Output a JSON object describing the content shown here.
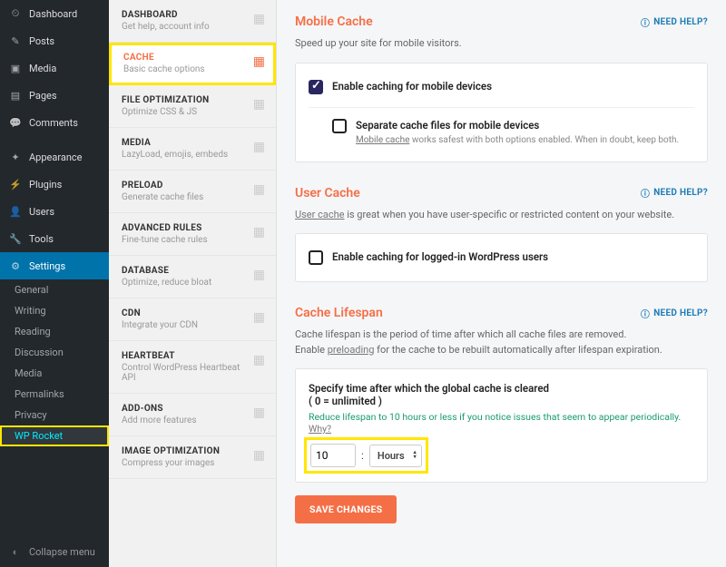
{
  "wp_sidebar": {
    "items": [
      {
        "label": "Dashboard",
        "icon": "speed"
      },
      {
        "label": "Posts",
        "icon": "pin"
      },
      {
        "label": "Media",
        "icon": "media"
      },
      {
        "label": "Pages",
        "icon": "page"
      },
      {
        "label": "Comments",
        "icon": "comment"
      },
      {
        "label": "Appearance",
        "icon": "brush"
      },
      {
        "label": "Plugins",
        "icon": "plug"
      },
      {
        "label": "Users",
        "icon": "user"
      },
      {
        "label": "Tools",
        "icon": "wrench"
      },
      {
        "label": "Settings",
        "icon": "gear",
        "active": true
      }
    ],
    "subitems": [
      {
        "label": "General"
      },
      {
        "label": "Writing"
      },
      {
        "label": "Reading"
      },
      {
        "label": "Discussion"
      },
      {
        "label": "Media"
      },
      {
        "label": "Permalinks"
      },
      {
        "label": "Privacy"
      },
      {
        "label": "WP Rocket",
        "highlight": true
      }
    ],
    "collapse": "Collapse menu"
  },
  "rocket_nav": [
    {
      "title": "DASHBOARD",
      "sub": "Get help, account info"
    },
    {
      "title": "CACHE",
      "sub": "Basic cache options",
      "active": true
    },
    {
      "title": "FILE OPTIMIZATION",
      "sub": "Optimize CSS & JS"
    },
    {
      "title": "MEDIA",
      "sub": "LazyLoad, emojis, embeds"
    },
    {
      "title": "PRELOAD",
      "sub": "Generate cache files"
    },
    {
      "title": "ADVANCED RULES",
      "sub": "Fine-tune cache rules"
    },
    {
      "title": "DATABASE",
      "sub": "Optimize, reduce bloat"
    },
    {
      "title": "CDN",
      "sub": "Integrate your CDN"
    },
    {
      "title": "HEARTBEAT",
      "sub": "Control WordPress Heartbeat API"
    },
    {
      "title": "ADD-ONS",
      "sub": "Add more features"
    },
    {
      "title": "IMAGE OPTIMIZATION",
      "sub": "Compress your images"
    }
  ],
  "help": "NEED HELP?",
  "mobile": {
    "title": "Mobile Cache",
    "desc": "Speed up your site for mobile visitors.",
    "opt1": "Enable caching for mobile devices",
    "opt2": "Separate cache files for mobile devices",
    "note_prefix": "Mobile cache",
    "note_rest": " works safest with both options enabled. When in doubt, keep both."
  },
  "user": {
    "title": "User Cache",
    "desc_prefix": "User cache",
    "desc_rest": " is great when you have user-specific or restricted content on your website.",
    "opt1": "Enable caching for logged-in WordPress users"
  },
  "lifespan": {
    "title": "Cache Lifespan",
    "desc_line1": "Cache lifespan is the period of time after which all cache files are removed.",
    "desc_enable": "Enable ",
    "desc_preloading": "preloading",
    "desc_rest": " for the cache to be rebuilt automatically after lifespan expiration.",
    "spec_title": "Specify time after which the global cache is cleared",
    "spec_sub": "( 0 = unlimited )",
    "hint": "Reduce lifespan to 10 hours or less if you notice issues that seem to appear periodically. ",
    "why": "Why?",
    "value": "10",
    "unit": "Hours"
  },
  "save": "SAVE CHANGES"
}
